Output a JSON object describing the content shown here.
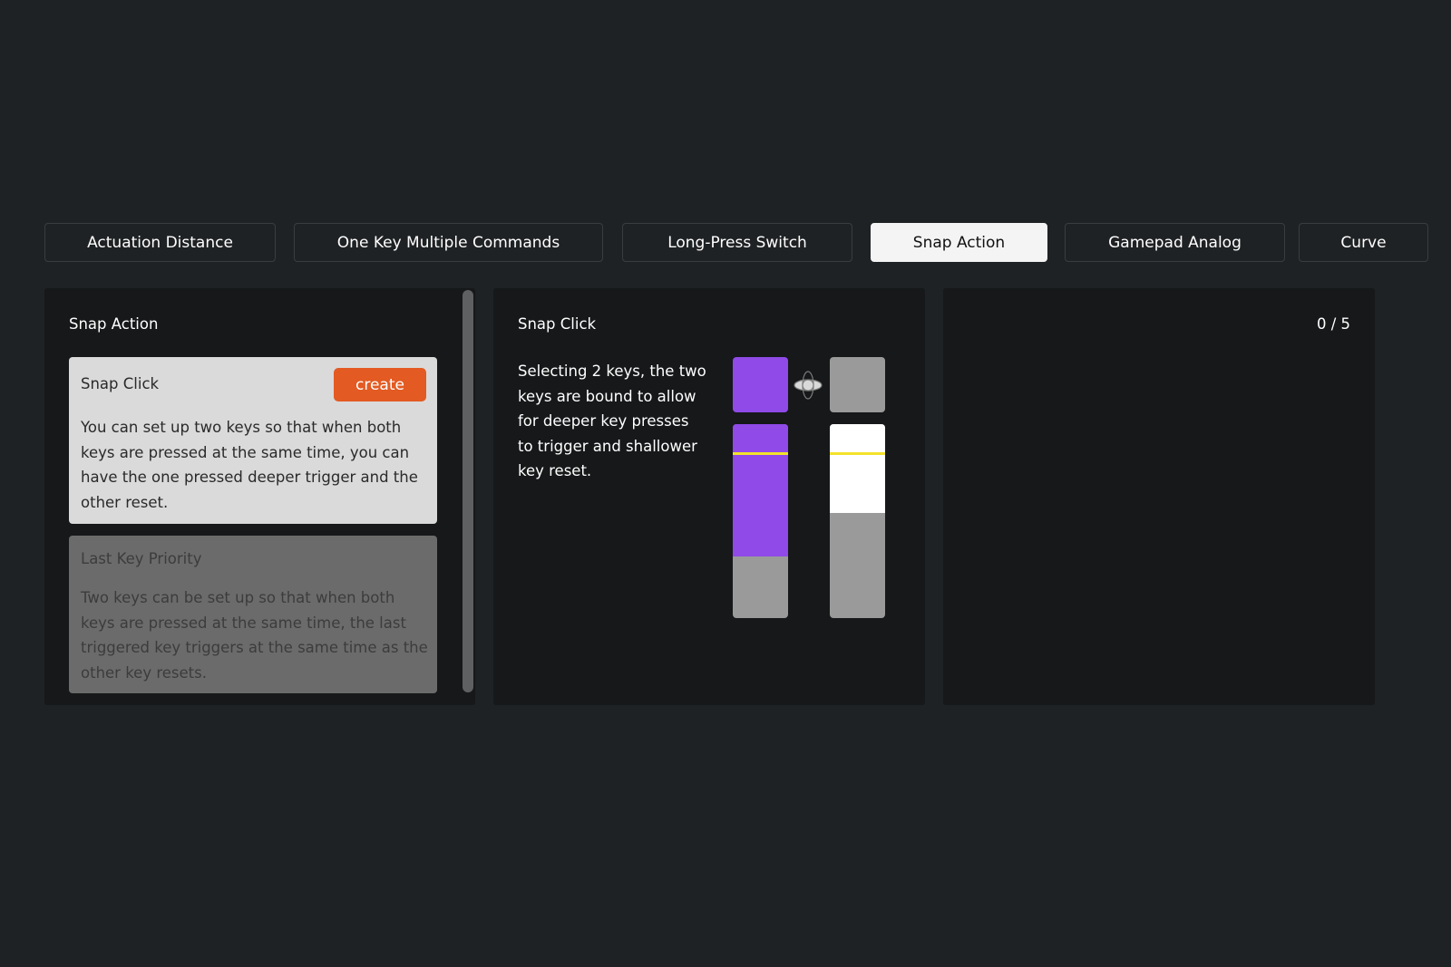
{
  "tabs": [
    {
      "label": "Actuation Distance",
      "active": false
    },
    {
      "label": "One Key Multiple Commands",
      "active": false
    },
    {
      "label": "Long-Press Switch",
      "active": false
    },
    {
      "label": "Snap Action",
      "active": true
    },
    {
      "label": "Gamepad Analog",
      "active": false
    },
    {
      "label": "Curve",
      "active": false
    }
  ],
  "left_panel": {
    "title": "Snap Action",
    "cards": [
      {
        "title": "Snap Click",
        "button": "create",
        "description": "You can set up two keys so that when both keys are pressed at the same time, you can have the one pressed deeper trigger and the other reset."
      },
      {
        "title": "Last Key Priority",
        "description": "Two keys can be set up so that when both keys are pressed at the same time, the last triggered key triggers at the same time as the other key resets."
      }
    ]
  },
  "middle_panel": {
    "title": "Snap Click",
    "description": "Selecting 2 keys, the two keys are bound to allow for deeper key presses to trigger and shallower key reset.",
    "illustration": {
      "left_key_color": "#8f4ae8",
      "right_key_color": "#9a9a9a",
      "left_press_fraction": 0.68,
      "right_press_fraction": 0.46,
      "link_icon": "link-orbit-icon"
    }
  },
  "right_panel": {
    "counter": "0 / 5"
  },
  "colors": {
    "background": "#1f2224",
    "panel": "#161819",
    "accent": "#e35a22",
    "purple": "#8f4ae8",
    "trigger_line": "#f2e22a"
  }
}
